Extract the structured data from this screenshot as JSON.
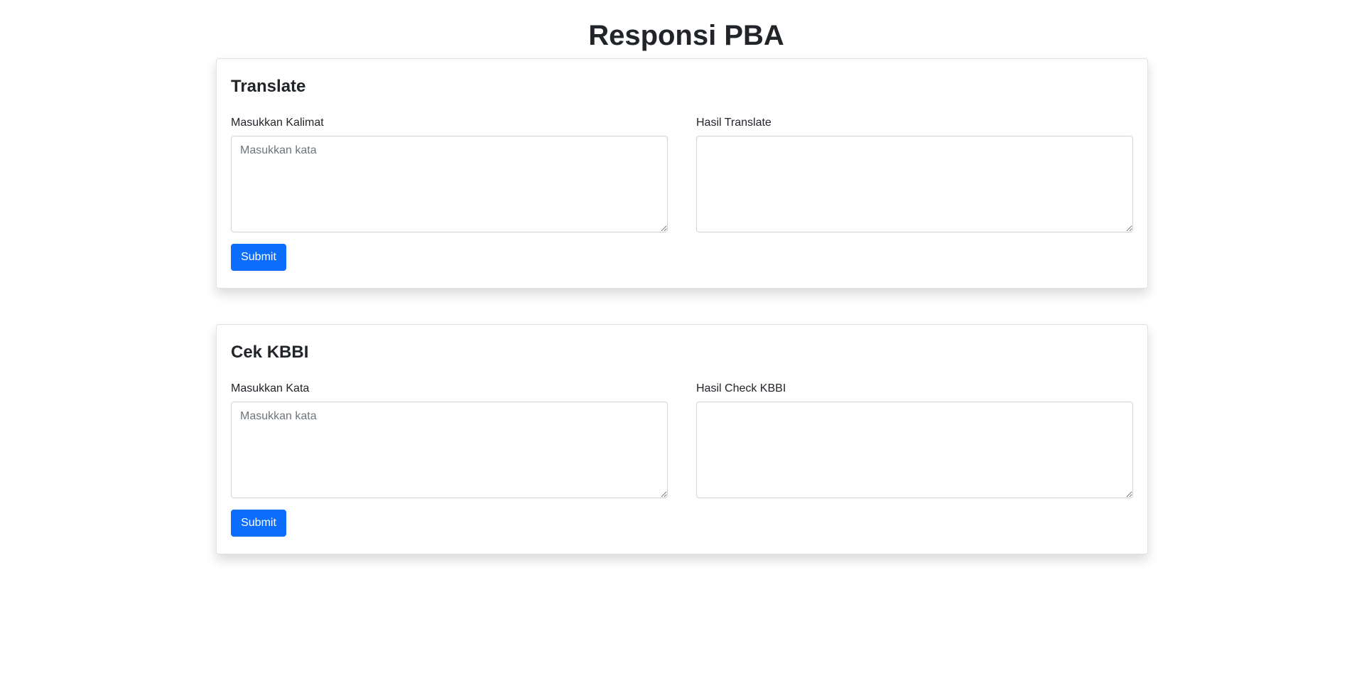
{
  "page": {
    "title": "Responsi PBA"
  },
  "translate": {
    "title": "Translate",
    "input_label": "Masukkan Kalimat",
    "input_placeholder": "Masukkan kata",
    "input_value": "",
    "output_label": "Hasil Translate",
    "output_value": "",
    "submit_label": "Submit"
  },
  "kbbi": {
    "title": "Cek KBBI",
    "input_label": "Masukkan Kata",
    "input_placeholder": "Masukkan kata",
    "input_value": "",
    "output_label": "Hasil Check KBBI",
    "output_value": "",
    "submit_label": "Submit"
  },
  "colors": {
    "primary": "#0d6efd",
    "text": "#212529",
    "placeholder": "#6c757d",
    "border": "#ced4da"
  }
}
